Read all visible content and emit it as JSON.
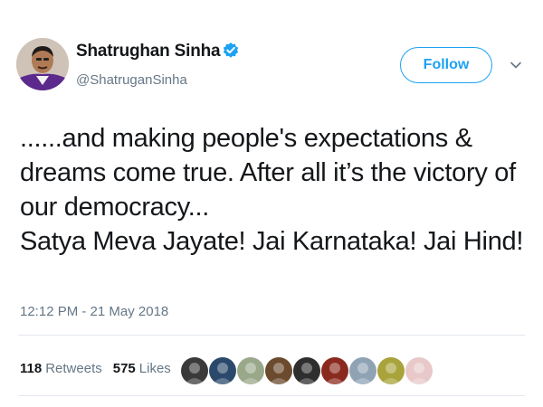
{
  "author": {
    "name": "Shatrughan Sinha",
    "handle": "@ShatruganSinha",
    "verified": true,
    "avatar_icon": "user-avatar"
  },
  "actions": {
    "follow_label": "Follow",
    "more_icon": "chevron-down-icon"
  },
  "tweet": {
    "lines": [
      "......and making people's expectations &",
      "dreams come true. After all it’s the victory of",
      "our democracy...",
      "Satya Meva Jayate! Jai Karnataka! Jai Hind!"
    ],
    "timestamp": "12:12 PM - 21 May 2018"
  },
  "stats": {
    "retweets_count": "118",
    "retweets_label": "Retweets",
    "likes_count": "575",
    "likes_label": "Likes"
  },
  "likers": [
    {
      "icon": "liker-avatar-1",
      "color": "#3a3a3a"
    },
    {
      "icon": "liker-avatar-2",
      "color": "#2b4a6b"
    },
    {
      "icon": "liker-avatar-3",
      "color": "#9aa88a"
    },
    {
      "icon": "liker-avatar-4",
      "color": "#6b4a2e"
    },
    {
      "icon": "liker-avatar-5",
      "color": "#2e2e2e"
    },
    {
      "icon": "liker-avatar-6",
      "color": "#8a2a1e"
    },
    {
      "icon": "liker-avatar-7",
      "color": "#8fa3b5"
    },
    {
      "icon": "liker-avatar-8",
      "color": "#a8a33a"
    },
    {
      "icon": "liker-avatar-9",
      "color": "#e8c8c8"
    }
  ],
  "colors": {
    "accent": "#1da1f2",
    "secondary_text": "#657786",
    "primary_text": "#14171a",
    "divider": "#e1e8ed"
  }
}
